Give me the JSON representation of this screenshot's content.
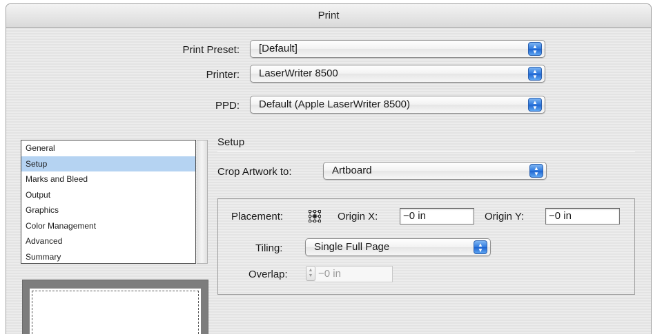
{
  "window": {
    "title": "Print"
  },
  "top_fields": {
    "print_preset": {
      "label": "Print Preset:",
      "value": "[Default]"
    },
    "printer": {
      "label": "Printer:",
      "value": "LaserWriter 8500"
    },
    "ppd": {
      "label": "PPD:",
      "value": "Default (Apple LaserWriter 8500)"
    }
  },
  "sidebar": {
    "items": [
      {
        "label": "General"
      },
      {
        "label": "Setup"
      },
      {
        "label": "Marks and Bleed"
      },
      {
        "label": "Output"
      },
      {
        "label": "Graphics"
      },
      {
        "label": "Color Management"
      },
      {
        "label": "Advanced"
      },
      {
        "label": "Summary"
      }
    ],
    "selected": "Setup"
  },
  "setup": {
    "title": "Setup",
    "crop_artwork": {
      "label": "Crop Artwork to:",
      "value": "Artboard"
    },
    "placement": {
      "label": "Placement:",
      "icon": "placement-grid-icon"
    },
    "origin_x": {
      "label": "Origin X:",
      "value": "−0 in"
    },
    "origin_y": {
      "label": "Origin Y:",
      "value": "−0 in"
    },
    "tiling": {
      "label": "Tiling:",
      "value": "Single Full Page"
    },
    "overlap": {
      "label": "Overlap:",
      "value": "−0 in"
    }
  },
  "colors": {
    "accent": "#2f79de",
    "selection": "#b5d3f2"
  }
}
